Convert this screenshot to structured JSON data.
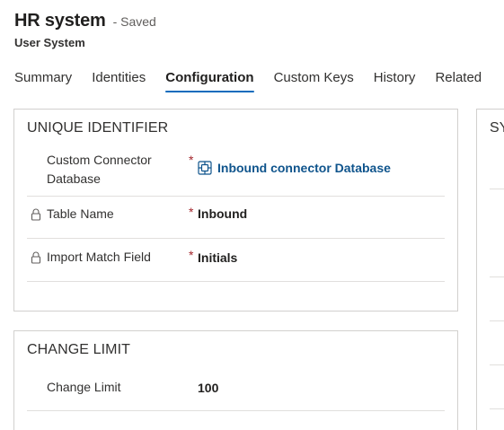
{
  "header": {
    "title": "HR system",
    "saved_status": "- Saved",
    "subtitle": "User System"
  },
  "tabs": [
    {
      "label": "Summary",
      "active": false
    },
    {
      "label": "Identities",
      "active": false
    },
    {
      "label": "Configuration",
      "active": true
    },
    {
      "label": "Custom Keys",
      "active": false
    },
    {
      "label": "History",
      "active": false
    },
    {
      "label": "Related",
      "active": false
    }
  ],
  "unique_identifier": {
    "title": "UNIQUE IDENTIFIER",
    "fields": [
      {
        "label": "Custom Connector Database",
        "required": "*",
        "value": "Inbound connector Database",
        "is_link": true,
        "icon": "connector-icon"
      },
      {
        "label": "Table Name",
        "required": "*",
        "value": "Inbound",
        "locked": true,
        "icon": "lock-icon"
      },
      {
        "label": "Import Match Field",
        "required": "*",
        "value": "Initials",
        "locked": true,
        "icon": "lock-icon"
      }
    ]
  },
  "change_limit": {
    "title": "CHANGE LIMIT",
    "fields": [
      {
        "label": "Change Limit",
        "value": "100"
      }
    ]
  },
  "right_section": {
    "title": "SY"
  },
  "colors": {
    "accent": "#0f6cbd",
    "link": "#0f548c",
    "required": "#a4262c",
    "border": "#d2d0ce"
  }
}
